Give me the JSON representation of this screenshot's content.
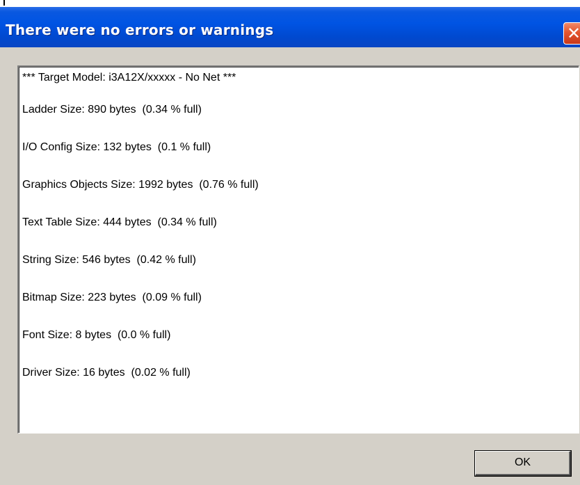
{
  "dialog": {
    "title": "There were no errors or warnings",
    "close_glyph": "✕",
    "ok_label": "OK"
  },
  "report": {
    "lines": [
      "*** Target Model: i3A12X/xxxxx - No Net ***",
      "Ladder Size: 890 bytes  (0.34 % full)",
      "I/O Config Size: 132 bytes  (0.1 % full)",
      "Graphics Objects Size: 1992 bytes  (0.76 % full)",
      "Text Table Size: 444 bytes  (0.34 % full)",
      "String Size: 546 bytes  (0.42 % full)",
      "Bitmap Size: 223 bytes  (0.09 % full)",
      "Font Size: 8 bytes  (0.0 % full)",
      "Driver Size: 16 bytes  (0.02 % full)"
    ]
  },
  "colors": {
    "titlebar": "#0054e3",
    "close_button": "#e4552e",
    "face": "#d4d0c8"
  }
}
